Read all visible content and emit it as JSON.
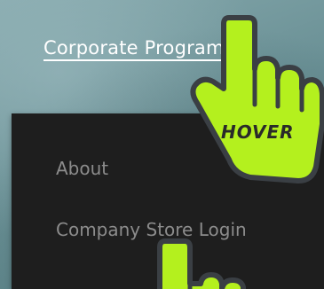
{
  "nav": {
    "active_link": "Corporate Programs"
  },
  "dropdown": {
    "items": [
      {
        "label": "About"
      },
      {
        "label": "Company Store Login"
      }
    ]
  },
  "cursor": {
    "label": "HOVER",
    "color": "#b4f01e",
    "outline": "#3a3f44"
  },
  "colors": {
    "dropdown_bg": "#1e1e1e",
    "dropdown_text": "#8c8c8c",
    "nav_text": "#ffffff"
  }
}
